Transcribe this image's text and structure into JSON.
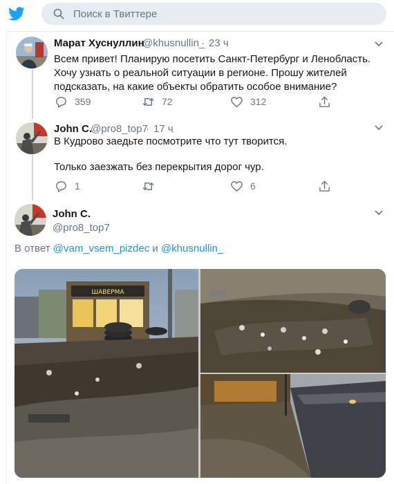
{
  "search": {
    "placeholder": "Поиск в Твиттере"
  },
  "colors": {
    "brand": "#1da1f2",
    "link": "#1b95e0",
    "muted": "#657786",
    "text": "#14171a",
    "search_bg": "#e6ecf0"
  },
  "tweets": [
    {
      "name": "Марат Хуснуллин",
      "handle": "@khusnullin_",
      "separator": "·",
      "time": "23 ч",
      "text": "Всем привет! Планирую посетить Санкт-Петербург и Ленобласть. Хочу узнать о реальной ситуации в регионе. Прошу жителей подсказать, на какие объекты обратить особое внимание?",
      "replies": "359",
      "retweets": "72",
      "likes": "312"
    },
    {
      "name": "John C.",
      "handle": "@pro8_top7",
      "separator": "·",
      "time": "17 ч",
      "text_line1": "В Кудрово заедьте посмотрите что тут творится.",
      "text_line2": "Только заезжать без перекрытия дорог чур.",
      "replies": "1",
      "retweets": "",
      "likes": "6"
    }
  ],
  "focused_tweet": {
    "name": "John C.",
    "handle": "@pro8_top7",
    "reply_prefix": "В ответ",
    "mention1": "@vam_vsem_pizdec",
    "conjunction": "и",
    "mention2": "@khusnullin_",
    "shop_sign": "ШАВЕРМА"
  },
  "icons": [
    "twitter-logo-icon",
    "search-icon",
    "chevron-down-icon",
    "reply-icon",
    "retweet-icon",
    "like-icon",
    "share-icon"
  ]
}
